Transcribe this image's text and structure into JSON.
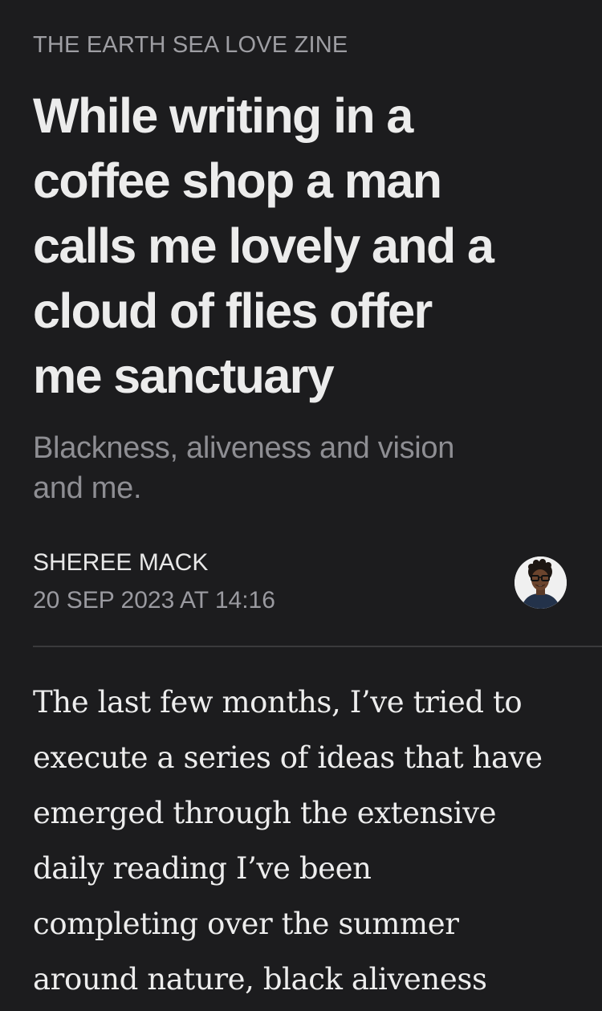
{
  "article": {
    "publication": "THE EARTH SEA LOVE ZINE",
    "title_lines": [
      "While writing in a",
      "coffee shop a man",
      "calls me lovely and a",
      "cloud of flies offer",
      "me sanctuary"
    ],
    "subtitle_lines": [
      "Blackness, aliveness and vision",
      "and me."
    ],
    "author": "SHEREE MACK",
    "date": "20 SEP 2023 AT 14:16",
    "avatar_icon": "author-avatar",
    "body_lines": [
      "The last few months, I’ve tried to",
      "execute a series of ideas that have",
      "emerged through the extensive",
      "daily reading I’ve been",
      "completing over the summer",
      "around nature, black aliveness"
    ]
  },
  "colors": {
    "background": "#1c1c1e",
    "title": "#ececec",
    "muted": "#8e8e93",
    "divider": "#3a3a3c"
  }
}
